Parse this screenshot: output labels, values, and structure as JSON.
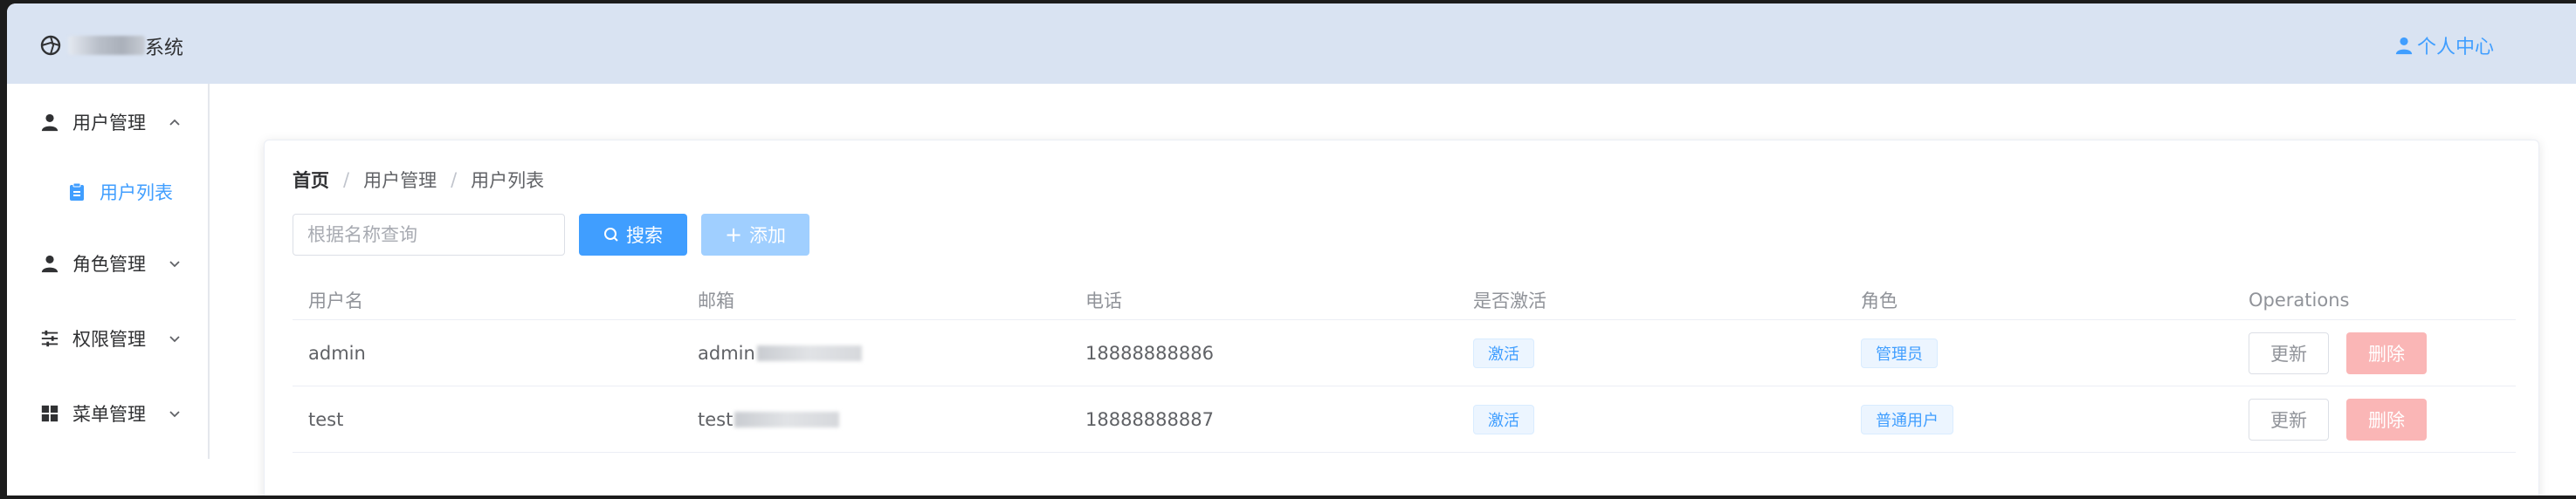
{
  "header": {
    "logo_icon": "aperture-icon",
    "app_title_suffix": "系统",
    "user_center_label": "个人中心",
    "user_icon": "user-icon"
  },
  "sidebar": {
    "items": [
      {
        "label": "用户管理",
        "icon": "user-icon",
        "expanded": true
      },
      {
        "label": "用户列表",
        "icon": "clipboard-icon",
        "active": true
      },
      {
        "label": "角色管理",
        "icon": "user-role-icon",
        "expanded": false
      },
      {
        "label": "权限管理",
        "icon": "sliders-icon",
        "expanded": false
      },
      {
        "label": "菜单管理",
        "icon": "grid-icon",
        "expanded": false
      }
    ]
  },
  "breadcrumb": {
    "home": "首页",
    "level1": "用户管理",
    "level2": "用户列表",
    "separator": "/"
  },
  "toolbar": {
    "search_placeholder": "根据名称查询",
    "search_value": "",
    "search_label": "搜索",
    "add_label": "添加"
  },
  "table": {
    "columns": [
      "用户名",
      "邮箱",
      "电话",
      "是否激活",
      "角色",
      "Operations"
    ],
    "rows": [
      {
        "username": "admin",
        "email_visible": "admin",
        "phone": "18888888886",
        "active": "激活",
        "role": "管理员",
        "update": "更新",
        "delete": "删除"
      },
      {
        "username": "test",
        "email_visible": "test",
        "phone": "18888888887",
        "active": "激活",
        "role": "普通用户",
        "update": "更新",
        "delete": "删除"
      }
    ]
  },
  "colors": {
    "primary": "#409eff",
    "header_bg": "#d9e3f2",
    "danger_light": "#fab6b6",
    "primary_light": "#a0cfff"
  }
}
